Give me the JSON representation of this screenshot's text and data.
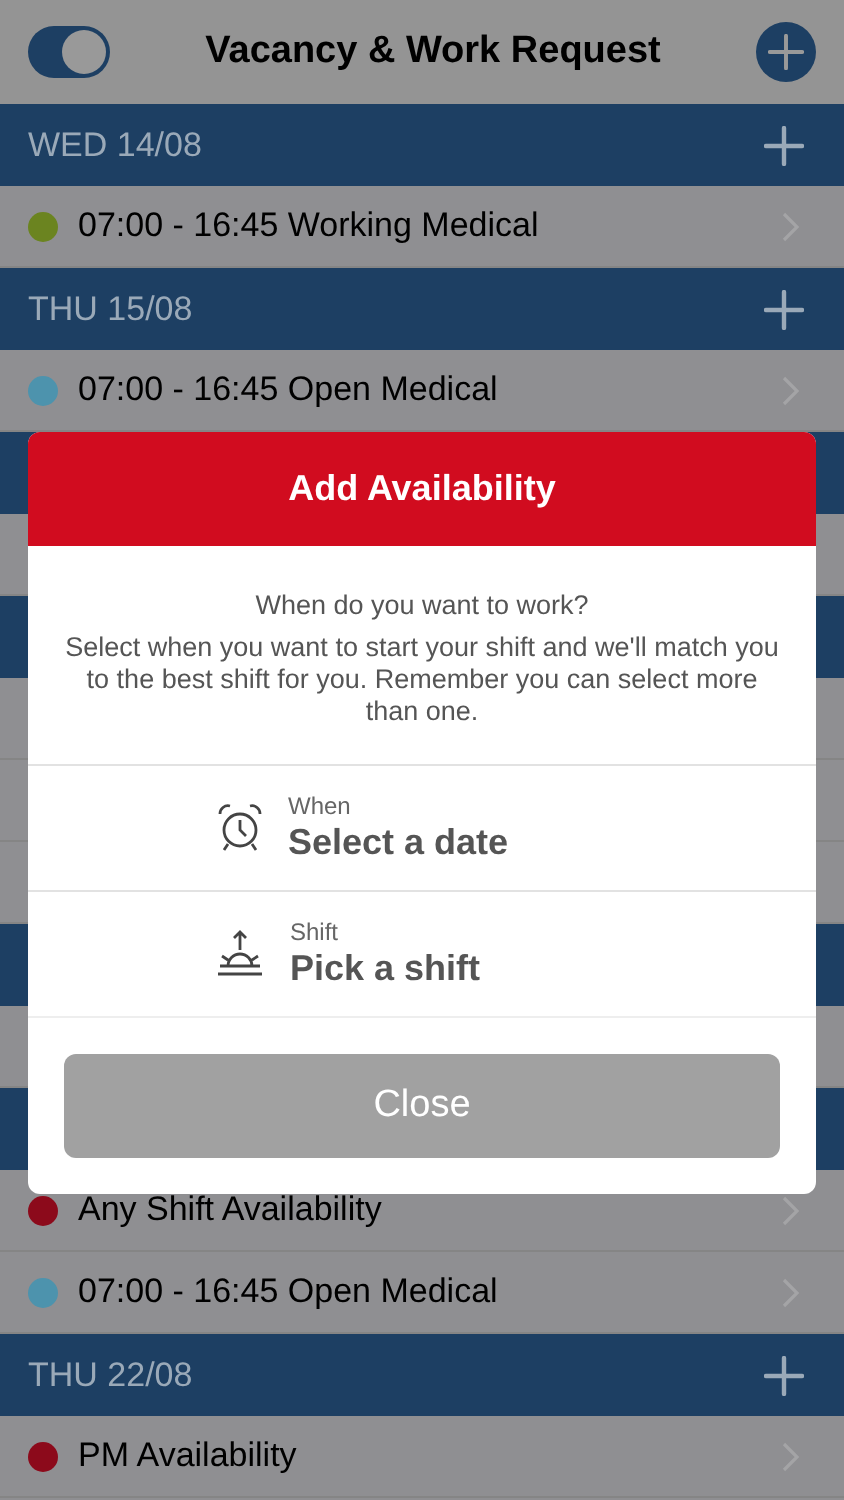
{
  "top_bar": {
    "toggle": {
      "on": true
    },
    "title": "Vacancy & Work Request"
  },
  "list": [
    {
      "kind": "header",
      "label": "WED 14/08"
    },
    {
      "kind": "row",
      "text": "07:00 - 16:45 Working Medical",
      "color": "#6b8420"
    },
    {
      "kind": "header",
      "label": "THU 15/08"
    },
    {
      "kind": "row",
      "text": "07:00 - 16:45 Open Medical",
      "color": "#4d93ad"
    },
    {
      "kind": "header"
    },
    {
      "kind": "row"
    },
    {
      "kind": "header"
    },
    {
      "kind": "row"
    },
    {
      "kind": "row"
    },
    {
      "kind": "row"
    },
    {
      "kind": "header"
    },
    {
      "kind": "row"
    },
    {
      "kind": "header"
    },
    {
      "kind": "row",
      "text": "Any Shift Availability",
      "color": "#8c0a1b"
    },
    {
      "kind": "row",
      "text": "07:00 - 16:45 Open Medical",
      "color": "#4d93ad"
    },
    {
      "kind": "header",
      "label": "THU 22/08"
    },
    {
      "kind": "row",
      "text": "PM Availability",
      "color": "#8c0a1b"
    }
  ],
  "dialog": {
    "title": "Add Availability",
    "question": "When do you want to work?",
    "message": "Select when you want to start your shift and we'll match you to the best shift for you. Remember you can select more than one.",
    "options": [
      {
        "kind": "date",
        "label": "When",
        "value": "Select a date"
      },
      {
        "kind": "shift",
        "label": "Shift",
        "value": "Pick a shift"
      }
    ],
    "button": "Close"
  }
}
